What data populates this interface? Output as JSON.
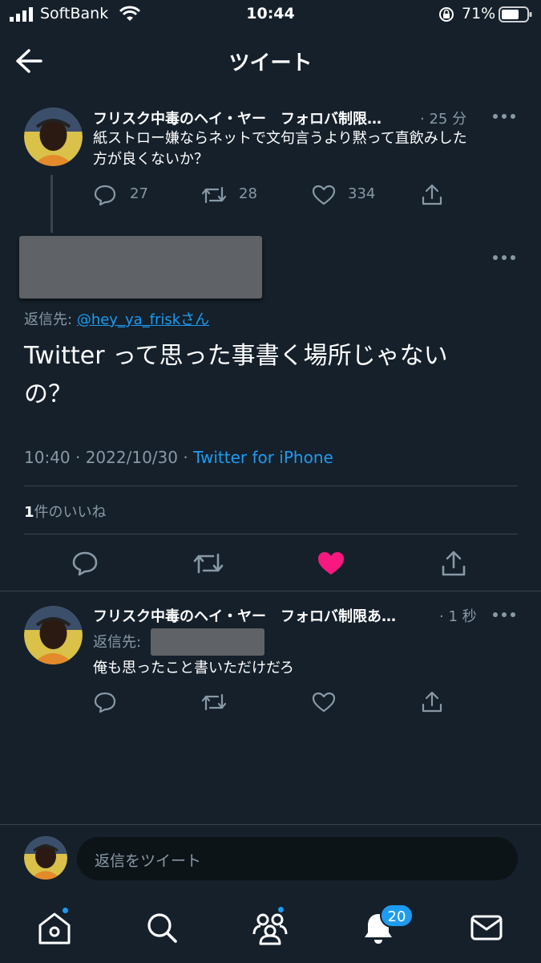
{
  "status_bar": {
    "carrier": "SoftBank",
    "time": "10:44",
    "battery_percent": "71%"
  },
  "header": {
    "title": "ツイート",
    "back_icon": "arrow-left-icon"
  },
  "parent_tweet": {
    "author": "フリスク中毒のヘイ・ヤー　フォロバ制限…",
    "time_ago": "· 25 分",
    "text_line1": "紙ストロー嫌ならネットで文句言うより黙って直飲みした",
    "text_line2": "方が良くないか？",
    "replies": "27",
    "retweets": "28",
    "likes": "334"
  },
  "main_tweet": {
    "reply_to_label": "返信先:",
    "reply_to_handle": "@hey_ya_frisk",
    "reply_to_suffix": "さん",
    "text_line1": "Twitter って思った事書く場所じゃない",
    "text_line2": "の？",
    "time": "10:40 · 2022/10/30 · ",
    "source": "Twitter for iPhone",
    "likes_count": "1",
    "likes_label": "件のいいね",
    "liked": true,
    "like_color": "#f91880"
  },
  "reply_tweet": {
    "author": "フリスク中毒のヘイ・ヤー　フォロバ制限あ…",
    "time_ago": "· 1 秒",
    "reply_to_label": "返信先:",
    "text": "俺も思ったこと書いただけだろ"
  },
  "composer": {
    "placeholder": "返信をツイート"
  },
  "tab_bar": {
    "items": [
      "home-icon",
      "search-icon",
      "communities-icon",
      "notifications-icon",
      "messages-icon"
    ],
    "notification_count": "20"
  },
  "colors": {
    "background": "#15202b",
    "accent": "#1d9bf0",
    "secondary_text": "#8899a6"
  }
}
